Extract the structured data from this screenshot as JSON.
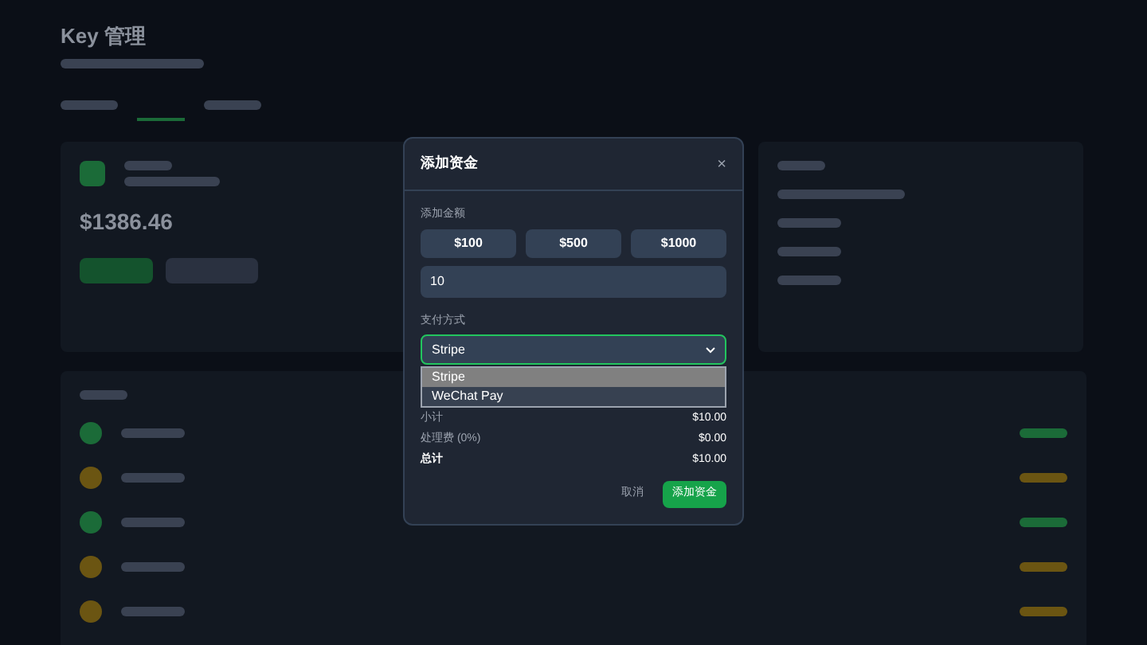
{
  "page": {
    "title": "Key 管理",
    "balance": "$1386.46",
    "list_rows": [
      {
        "color": "#1b6b38"
      },
      {
        "color": "#6b5512"
      },
      {
        "color": "#1b6b38"
      },
      {
        "color": "#6b5512"
      },
      {
        "color": "#6b5512"
      }
    ]
  },
  "dialog": {
    "title": "添加资金",
    "close": "×",
    "amount_label": "添加金额",
    "presets": [
      "$100",
      "$500",
      "$1000"
    ],
    "amount_value": "10",
    "method_label": "支付方式",
    "method_value": "Stripe",
    "options": [
      {
        "label": "Stripe",
        "selected": true
      },
      {
        "label": "WeChat Pay",
        "selected": false
      }
    ],
    "summary": [
      {
        "label": "小计",
        "value": "$10.00",
        "kind": "normal"
      },
      {
        "label": "处理费 (0%)",
        "value": "$0.00",
        "kind": "normal"
      },
      {
        "label": "总计",
        "value": "$10.00",
        "kind": "total"
      }
    ],
    "cancel": "取消",
    "submit": "添加资金"
  }
}
